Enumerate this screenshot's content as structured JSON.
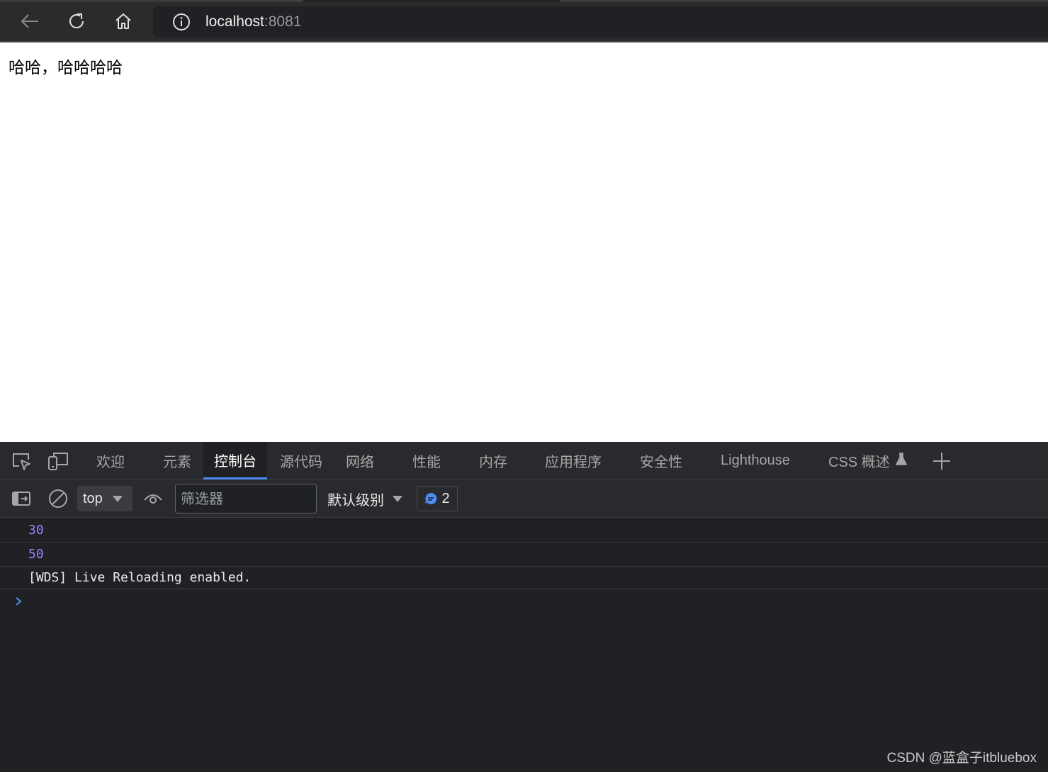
{
  "browser": {
    "url_host": "localhost",
    "url_port": ":8081",
    "icons": [
      "back-arrow-icon",
      "reload-icon",
      "home-icon",
      "site-info-icon"
    ]
  },
  "page": {
    "text": "哈哈，哈哈哈哈"
  },
  "devtools": {
    "tabs": [
      {
        "label": "欢迎"
      },
      {
        "label": "元素"
      },
      {
        "label": "控制台",
        "active": true
      },
      {
        "label": "源代码"
      },
      {
        "label": "网络"
      },
      {
        "label": "性能"
      },
      {
        "label": "内存"
      },
      {
        "label": "应用程序"
      },
      {
        "label": "安全性"
      },
      {
        "label": "Lighthouse"
      },
      {
        "label": "CSS 概述"
      }
    ],
    "toolbar": {
      "context": "top",
      "filter_placeholder": "筛选器",
      "levels": "默认级别",
      "issues_count": "2"
    },
    "console": {
      "messages": [
        "30",
        "50",
        "[WDS] Live Reloading enabled."
      ]
    }
  },
  "watermark": "CSDN @蓝盒子itbluebox",
  "colors": {
    "accent": "#4c8df6",
    "number_log": "#9980ff",
    "devtools_bg": "#202124"
  }
}
